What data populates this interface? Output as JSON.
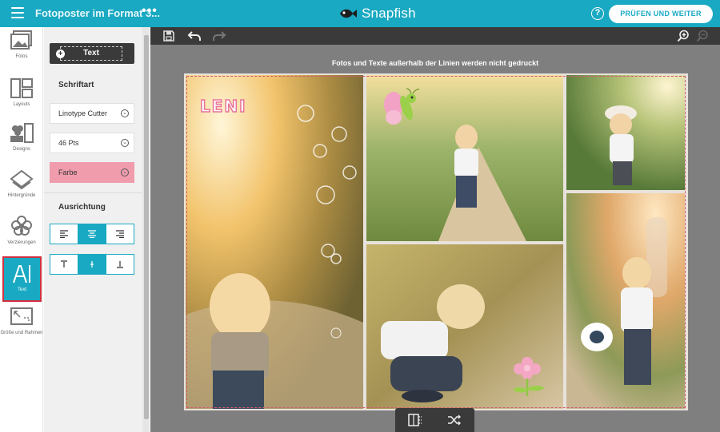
{
  "header": {
    "doc_title": "Fotoposter im Format 3...",
    "more_label": "•••",
    "brand": "Snapfish",
    "help_label": "?",
    "cta_label": "PRÜFEN UND WEITER"
  },
  "rail": {
    "items": [
      {
        "label": "Fotos",
        "icon": "photos-icon"
      },
      {
        "label": "Layouts",
        "icon": "layouts-icon"
      },
      {
        "label": "Designs",
        "icon": "designs-icon"
      },
      {
        "label": "Hintergründe",
        "icon": "backgrounds-icon"
      },
      {
        "label": "Verzierungen",
        "icon": "embellishments-icon"
      },
      {
        "label": "Text",
        "icon": "text-icon",
        "active": true
      },
      {
        "label": "Größe und Rahmen",
        "icon": "size-frame-icon"
      }
    ]
  },
  "panel": {
    "add_text_label": "Text",
    "font_section": "Schriftart",
    "font_family": "Linotype Cutter",
    "font_size": "46 Pts",
    "color_label": "Farbe",
    "color_value": "#f09cad",
    "align_section": "Ausrichtung",
    "horizontal_align_selected": "center",
    "vertical_align_selected": "middle"
  },
  "canvas": {
    "notice": "Fotos und Texte außerhalb der Linien werden nicht gedruckt",
    "text_element": "LENI",
    "accent_color": "#1aa9c2",
    "cut_line_color": "#d25a6d"
  }
}
